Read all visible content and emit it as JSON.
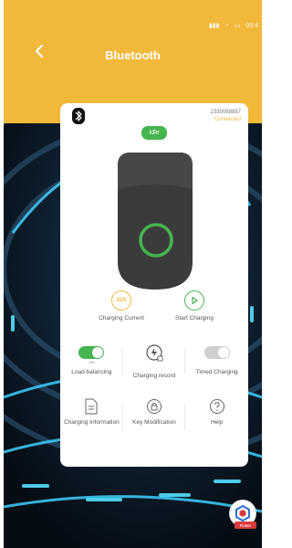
{
  "header": {
    "title": "Bluetooth",
    "color": "#f2b83a"
  },
  "status_bar": {
    "time": "09:4"
  },
  "device": {
    "id": "2330088887",
    "connection": "Connected",
    "state": "Idle"
  },
  "actions_row1": {
    "current_value": "32A",
    "current_label": "Charging Current",
    "start_label": "Start Charging"
  },
  "actions_row2": {
    "load_balancing_label": "Load balancing",
    "load_balancing_sub": "ON",
    "load_balancing_on": true,
    "record_label": "Charging record",
    "timed_label": "Timed Charging",
    "timed_on": false
  },
  "actions_row3": {
    "info_label": "Charging Information",
    "key_label": "Key Modification",
    "help_label": "Help"
  },
  "flutter": {
    "tag": "Flutter"
  },
  "colors": {
    "accent_yellow": "#f2b83a",
    "accent_green": "#46b44f",
    "charger_body": "#3b3b3b"
  }
}
